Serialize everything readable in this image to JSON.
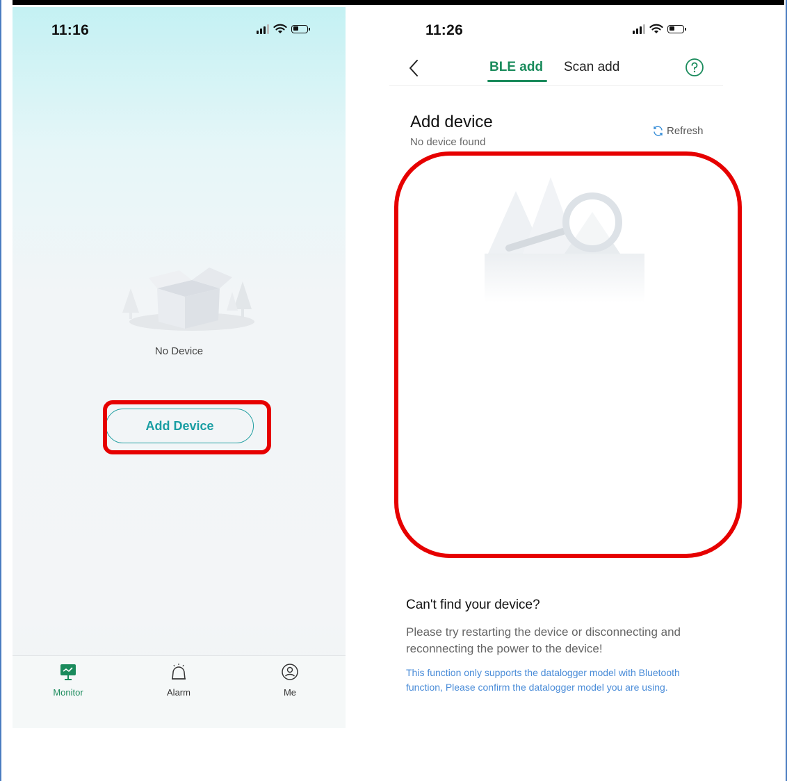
{
  "left_screen": {
    "status_time": "11:16",
    "empty_label": "No Device",
    "add_button_label": "Add Device",
    "tabs": [
      {
        "label": "Monitor",
        "icon": "monitor-icon",
        "active": true
      },
      {
        "label": "Alarm",
        "icon": "alarm-bell-icon",
        "active": false
      },
      {
        "label": "Me",
        "icon": "user-icon",
        "active": false
      }
    ]
  },
  "right_screen": {
    "status_time": "11:26",
    "tabs": [
      {
        "label": "BLE add",
        "active": true
      },
      {
        "label": "Scan add",
        "active": false
      }
    ],
    "title": "Add device",
    "subtitle": "No device found",
    "refresh_label": "Refresh",
    "help_title": "Can't find your device?",
    "help_text": "Please try restarting the device or disconnecting and reconnecting the power to the device!",
    "help_note": "This function only supports the datalogger model with Bluetooth function, Please confirm the datalogger model you are using."
  },
  "colors": {
    "accent_teal": "#1a9ea3",
    "accent_green": "#1a8b5c",
    "highlight_red": "#e60000",
    "note_blue": "#4a8cd8"
  }
}
